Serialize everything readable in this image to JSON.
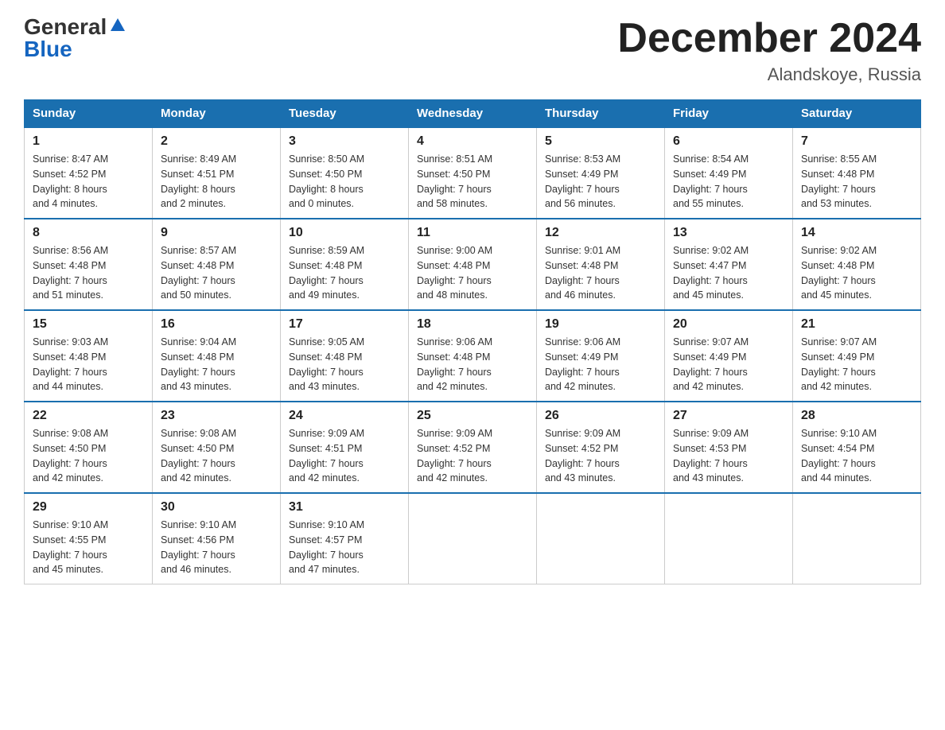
{
  "header": {
    "logo_general": "General",
    "logo_blue": "Blue",
    "month_title": "December 2024",
    "location": "Alandskoye, Russia"
  },
  "weekdays": [
    "Sunday",
    "Monday",
    "Tuesday",
    "Wednesday",
    "Thursday",
    "Friday",
    "Saturday"
  ],
  "weeks": [
    [
      {
        "day": "1",
        "sunrise": "8:47 AM",
        "sunset": "4:52 PM",
        "daylight": "8 hours and 4 minutes."
      },
      {
        "day": "2",
        "sunrise": "8:49 AM",
        "sunset": "4:51 PM",
        "daylight": "8 hours and 2 minutes."
      },
      {
        "day": "3",
        "sunrise": "8:50 AM",
        "sunset": "4:50 PM",
        "daylight": "8 hours and 0 minutes."
      },
      {
        "day": "4",
        "sunrise": "8:51 AM",
        "sunset": "4:50 PM",
        "daylight": "7 hours and 58 minutes."
      },
      {
        "day": "5",
        "sunrise": "8:53 AM",
        "sunset": "4:49 PM",
        "daylight": "7 hours and 56 minutes."
      },
      {
        "day": "6",
        "sunrise": "8:54 AM",
        "sunset": "4:49 PM",
        "daylight": "7 hours and 55 minutes."
      },
      {
        "day": "7",
        "sunrise": "8:55 AM",
        "sunset": "4:48 PM",
        "daylight": "7 hours and 53 minutes."
      }
    ],
    [
      {
        "day": "8",
        "sunrise": "8:56 AM",
        "sunset": "4:48 PM",
        "daylight": "7 hours and 51 minutes."
      },
      {
        "day": "9",
        "sunrise": "8:57 AM",
        "sunset": "4:48 PM",
        "daylight": "7 hours and 50 minutes."
      },
      {
        "day": "10",
        "sunrise": "8:59 AM",
        "sunset": "4:48 PM",
        "daylight": "7 hours and 49 minutes."
      },
      {
        "day": "11",
        "sunrise": "9:00 AM",
        "sunset": "4:48 PM",
        "daylight": "7 hours and 48 minutes."
      },
      {
        "day": "12",
        "sunrise": "9:01 AM",
        "sunset": "4:48 PM",
        "daylight": "7 hours and 46 minutes."
      },
      {
        "day": "13",
        "sunrise": "9:02 AM",
        "sunset": "4:47 PM",
        "daylight": "7 hours and 45 minutes."
      },
      {
        "day": "14",
        "sunrise": "9:02 AM",
        "sunset": "4:48 PM",
        "daylight": "7 hours and 45 minutes."
      }
    ],
    [
      {
        "day": "15",
        "sunrise": "9:03 AM",
        "sunset": "4:48 PM",
        "daylight": "7 hours and 44 minutes."
      },
      {
        "day": "16",
        "sunrise": "9:04 AM",
        "sunset": "4:48 PM",
        "daylight": "7 hours and 43 minutes."
      },
      {
        "day": "17",
        "sunrise": "9:05 AM",
        "sunset": "4:48 PM",
        "daylight": "7 hours and 43 minutes."
      },
      {
        "day": "18",
        "sunrise": "9:06 AM",
        "sunset": "4:48 PM",
        "daylight": "7 hours and 42 minutes."
      },
      {
        "day": "19",
        "sunrise": "9:06 AM",
        "sunset": "4:49 PM",
        "daylight": "7 hours and 42 minutes."
      },
      {
        "day": "20",
        "sunrise": "9:07 AM",
        "sunset": "4:49 PM",
        "daylight": "7 hours and 42 minutes."
      },
      {
        "day": "21",
        "sunrise": "9:07 AM",
        "sunset": "4:49 PM",
        "daylight": "7 hours and 42 minutes."
      }
    ],
    [
      {
        "day": "22",
        "sunrise": "9:08 AM",
        "sunset": "4:50 PM",
        "daylight": "7 hours and 42 minutes."
      },
      {
        "day": "23",
        "sunrise": "9:08 AM",
        "sunset": "4:50 PM",
        "daylight": "7 hours and 42 minutes."
      },
      {
        "day": "24",
        "sunrise": "9:09 AM",
        "sunset": "4:51 PM",
        "daylight": "7 hours and 42 minutes."
      },
      {
        "day": "25",
        "sunrise": "9:09 AM",
        "sunset": "4:52 PM",
        "daylight": "7 hours and 42 minutes."
      },
      {
        "day": "26",
        "sunrise": "9:09 AM",
        "sunset": "4:52 PM",
        "daylight": "7 hours and 43 minutes."
      },
      {
        "day": "27",
        "sunrise": "9:09 AM",
        "sunset": "4:53 PM",
        "daylight": "7 hours and 43 minutes."
      },
      {
        "day": "28",
        "sunrise": "9:10 AM",
        "sunset": "4:54 PM",
        "daylight": "7 hours and 44 minutes."
      }
    ],
    [
      {
        "day": "29",
        "sunrise": "9:10 AM",
        "sunset": "4:55 PM",
        "daylight": "7 hours and 45 minutes."
      },
      {
        "day": "30",
        "sunrise": "9:10 AM",
        "sunset": "4:56 PM",
        "daylight": "7 hours and 46 minutes."
      },
      {
        "day": "31",
        "sunrise": "9:10 AM",
        "sunset": "4:57 PM",
        "daylight": "7 hours and 47 minutes."
      },
      null,
      null,
      null,
      null
    ]
  ],
  "labels": {
    "sunrise": "Sunrise:",
    "sunset": "Sunset:",
    "daylight": "Daylight:"
  }
}
